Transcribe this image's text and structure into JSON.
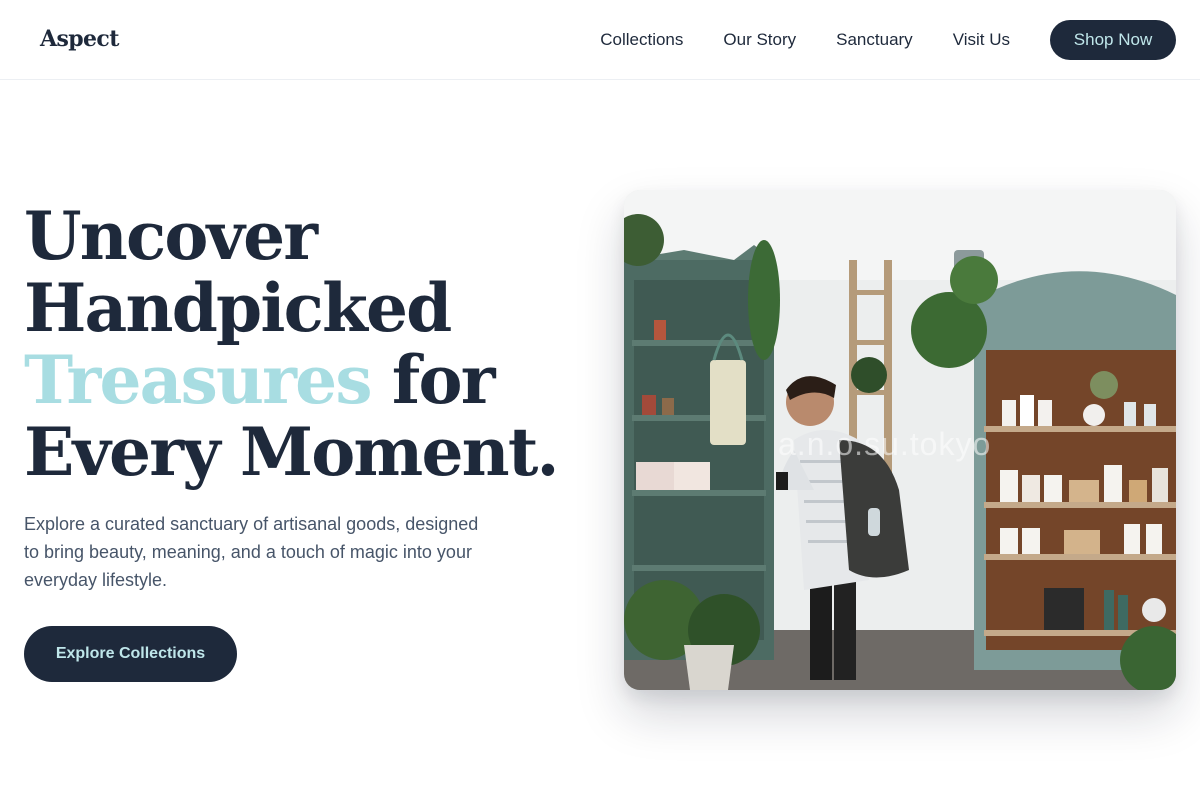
{
  "brand": {
    "logo": "Aspect"
  },
  "nav": {
    "links": [
      "Collections",
      "Our Story",
      "Sanctuary",
      "Visit Us"
    ],
    "cta_label": "Shop Now"
  },
  "hero": {
    "title_lines": [
      "Uncover",
      "Handpicked"
    ],
    "title_accent": "Treasures",
    "title_after_accent": " for",
    "title_last_line": "Every Moment.",
    "description": "Explore a curated sanctuary of artisanal goods, designed to bring beauty, meaning, and a touch of magic into your everyday lifestyle.",
    "cta_label": "Explore Collections",
    "image_watermark": "a.n.o.su.tokyo"
  },
  "colors": {
    "primary": "#1e293b",
    "accent": "#a8dde2",
    "button_text": "#bfe6ea",
    "body_text": "#475569"
  }
}
